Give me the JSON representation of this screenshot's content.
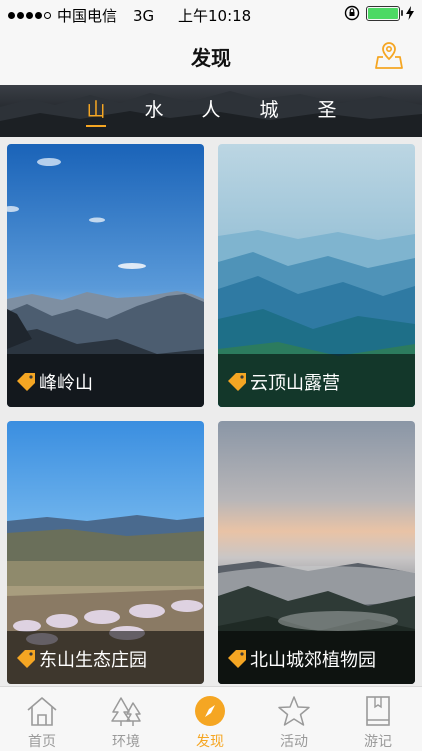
{
  "status_bar": {
    "carrier": "中国电信",
    "network": "3G",
    "time": "上午10:18"
  },
  "navbar": {
    "title": "发现",
    "map_icon": "map-pin-icon"
  },
  "categories": [
    {
      "label": "山",
      "active": true
    },
    {
      "label": "水",
      "active": false
    },
    {
      "label": "人",
      "active": false
    },
    {
      "label": "城",
      "active": false
    },
    {
      "label": "圣",
      "active": false
    }
  ],
  "cards": [
    {
      "title": "峰岭山",
      "scene": "blue-sky-mountains"
    },
    {
      "title": "云顶山露营",
      "scene": "misty-blue-ridges"
    },
    {
      "title": "东山生态庄园",
      "scene": "blossom-valley"
    },
    {
      "title": "北山城郊植物园",
      "scene": "dusk-fog-forest"
    }
  ],
  "tabbar": [
    {
      "label": "首页",
      "icon": "home-icon",
      "active": false
    },
    {
      "label": "环境",
      "icon": "trees-icon",
      "active": false
    },
    {
      "label": "发现",
      "icon": "compass-icon",
      "active": true
    },
    {
      "label": "活动",
      "icon": "star-icon",
      "active": false
    },
    {
      "label": "游记",
      "icon": "book-icon",
      "active": false
    }
  ],
  "colors": {
    "accent": "#f5a623",
    "inactive": "#9a9a9a",
    "background": "#ececec"
  }
}
